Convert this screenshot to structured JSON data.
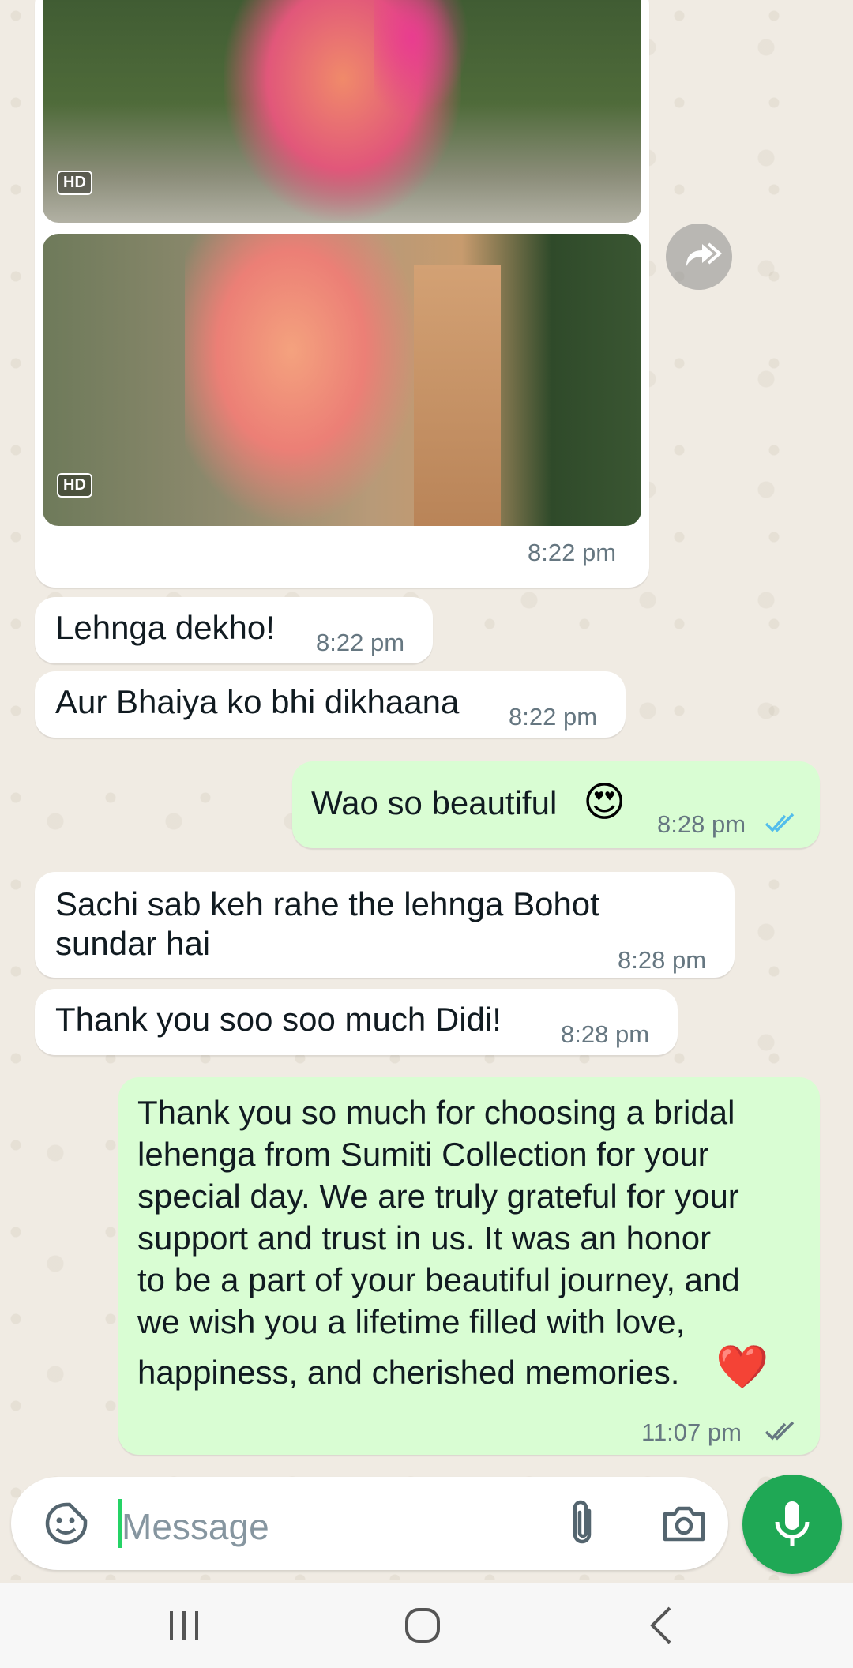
{
  "messages": [
    {
      "type": "image-group",
      "hd_label": "HD",
      "time": "8:22 pm"
    },
    {
      "type": "incoming",
      "text": "Lehnga dekho!",
      "time": "8:22 pm"
    },
    {
      "type": "incoming",
      "text": "Aur Bhaiya ko bhi dikhaana",
      "time": "8:22 pm"
    },
    {
      "type": "outgoing",
      "text": "Wao so beautiful",
      "emoji": "😍",
      "time": "8:28 pm",
      "status": "read"
    },
    {
      "type": "incoming",
      "text_line1": "Sachi sab keh rahe the lehnga Bohot",
      "text_line2": "sundar hai",
      "time": "8:28 pm"
    },
    {
      "type": "incoming",
      "text": "Thank you soo soo much Didi!",
      "time": "8:28 pm"
    },
    {
      "type": "outgoing",
      "lines": [
        "Thank you so much for choosing a bridal",
        "lehenga from Sumiti Collection for your",
        "special day. We are truly grateful for your",
        "support and trust in us. It was an honor",
        "to be a part of your beautiful journey, and",
        "we wish you a lifetime filled with love,",
        "happiness, and cherished memories."
      ],
      "emoji": "❤️",
      "time": "11:07 pm",
      "status": "delivered"
    }
  ],
  "composer": {
    "placeholder": "Message"
  },
  "icons": {
    "emoji": "sticker-icon",
    "attach": "paperclip-icon",
    "camera": "camera-icon",
    "mic": "mic-icon",
    "forward": "forward-icon",
    "nav_recents": "recents-icon",
    "nav_home": "home-icon",
    "nav_back": "back-icon"
  },
  "colors": {
    "incoming": "#ffffff",
    "outgoing": "#d9fdd3",
    "accent": "#1fa855",
    "read_tick": "#53bdeb",
    "time": "#667781"
  }
}
